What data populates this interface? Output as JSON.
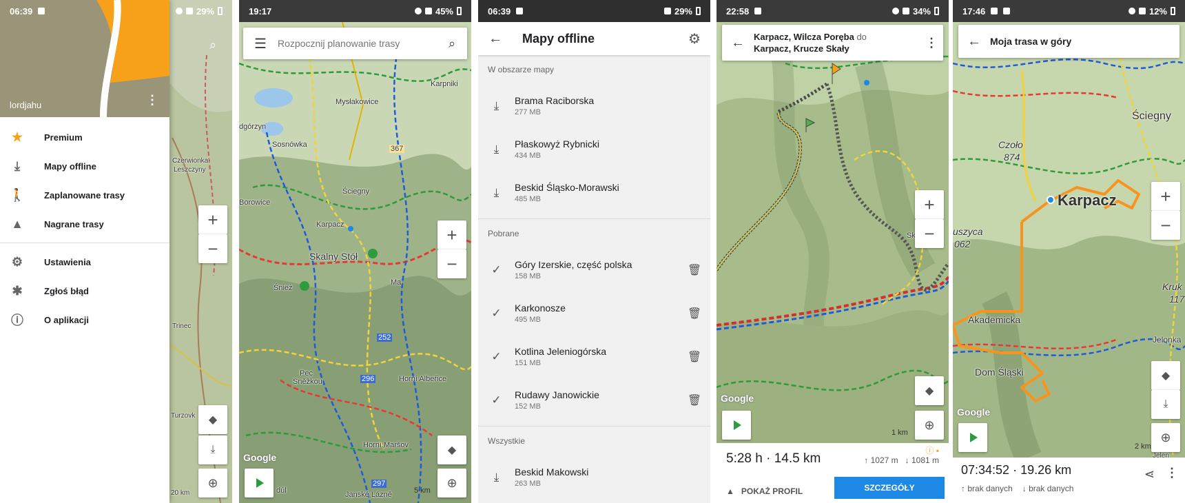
{
  "p1": {
    "status": {
      "time": "06:39",
      "battery": "29%"
    },
    "username": "lordjahu",
    "menu": [
      {
        "label": "Premium",
        "icon": "star-icon"
      },
      {
        "label": "Mapy offline",
        "icon": "download-icon"
      },
      {
        "label": "Zaplanowane trasy",
        "icon": "hiker-icon"
      },
      {
        "label": "Nagrane trasy",
        "icon": "navigation-arrow-icon"
      }
    ],
    "menu2": [
      {
        "label": "Ustawienia",
        "icon": "gear-icon"
      },
      {
        "label": "Zgłoś błąd",
        "icon": "bug-icon"
      },
      {
        "label": "O aplikacji",
        "icon": "info-icon"
      }
    ],
    "map_labels": [
      "Czerwionka-",
      "Leszczyny",
      "Trinec",
      "Turzovk",
      "20 km"
    ],
    "accent": "#f7a11a"
  },
  "p2": {
    "status": {
      "time": "19:17",
      "battery": "45%"
    },
    "search_placeholder": "Rozpocznij planowanie trasy",
    "map_labels": [
      "Karpniki",
      "Mysłakowice",
      "dgórzyn",
      "Sosnówka",
      "367",
      "Ściegny",
      "Borowice",
      "Karpacz",
      "Skalny Stół",
      "Śnież",
      "Ma",
      "252",
      "Pec",
      "Sněžkou",
      "Horní Albeřice",
      "296",
      "Horní Maršov",
      "297",
      "Janské Lázně",
      "dúl"
    ],
    "scale": "5 km"
  },
  "p3": {
    "status": {
      "time": "06:39",
      "battery": "29%"
    },
    "title": "Mapy offline",
    "sections": [
      {
        "header": "W obszarze mapy",
        "items": [
          {
            "name": "Brama Raciborska",
            "size": "277 MB",
            "downloaded": false
          },
          {
            "name": "Płaskowyż Rybnicki",
            "size": "434 MB",
            "downloaded": false
          },
          {
            "name": "Beskid Śląsko-Morawski",
            "size": "485 MB",
            "downloaded": false
          }
        ]
      },
      {
        "header": "Pobrane",
        "items": [
          {
            "name": "Góry Izerskie, część polska",
            "size": "158 MB",
            "downloaded": true
          },
          {
            "name": "Karkonosze",
            "size": "495 MB",
            "downloaded": true
          },
          {
            "name": "Kotlina Jeleniogórska",
            "size": "151 MB",
            "downloaded": true
          },
          {
            "name": "Rudawy Janowickie",
            "size": "152 MB",
            "downloaded": true
          }
        ]
      },
      {
        "header": "Wszystkie",
        "items": [
          {
            "name": "Beskid Makowski",
            "size": "263 MB",
            "downloaded": false
          }
        ]
      }
    ]
  },
  "p4": {
    "status": {
      "time": "22:58",
      "battery": "34%"
    },
    "route_from": "Karpacz, Wilcza Poręba",
    "route_do": "do",
    "route_to": "Karpacz, Krucze Skały",
    "duration": "5:28 h",
    "distance": "14.5 km",
    "ascent": "1027 m",
    "descent": "1081 m",
    "profile_label": "POKAŻ PROFIL",
    "details_label": "SZCZEGÓŁY",
    "scale": "1 km",
    "map_label_sk": "Sk"
  },
  "p5": {
    "status": {
      "time": "17:46",
      "battery": "12%"
    },
    "title": "Moja trasa w góry",
    "duration": "07:34:52",
    "distance": "19.26 km",
    "ascent_nodata": "brak danych",
    "descent_nodata": "brak danych",
    "scale": "2 km",
    "map_labels": [
      "Ściegny",
      "Czoło",
      "874",
      "Karpacz",
      "uszyca",
      "062",
      "Kruk",
      "117",
      "Akademicka",
      "Dom Śląski",
      "Jelonka",
      "Jelen"
    ]
  }
}
